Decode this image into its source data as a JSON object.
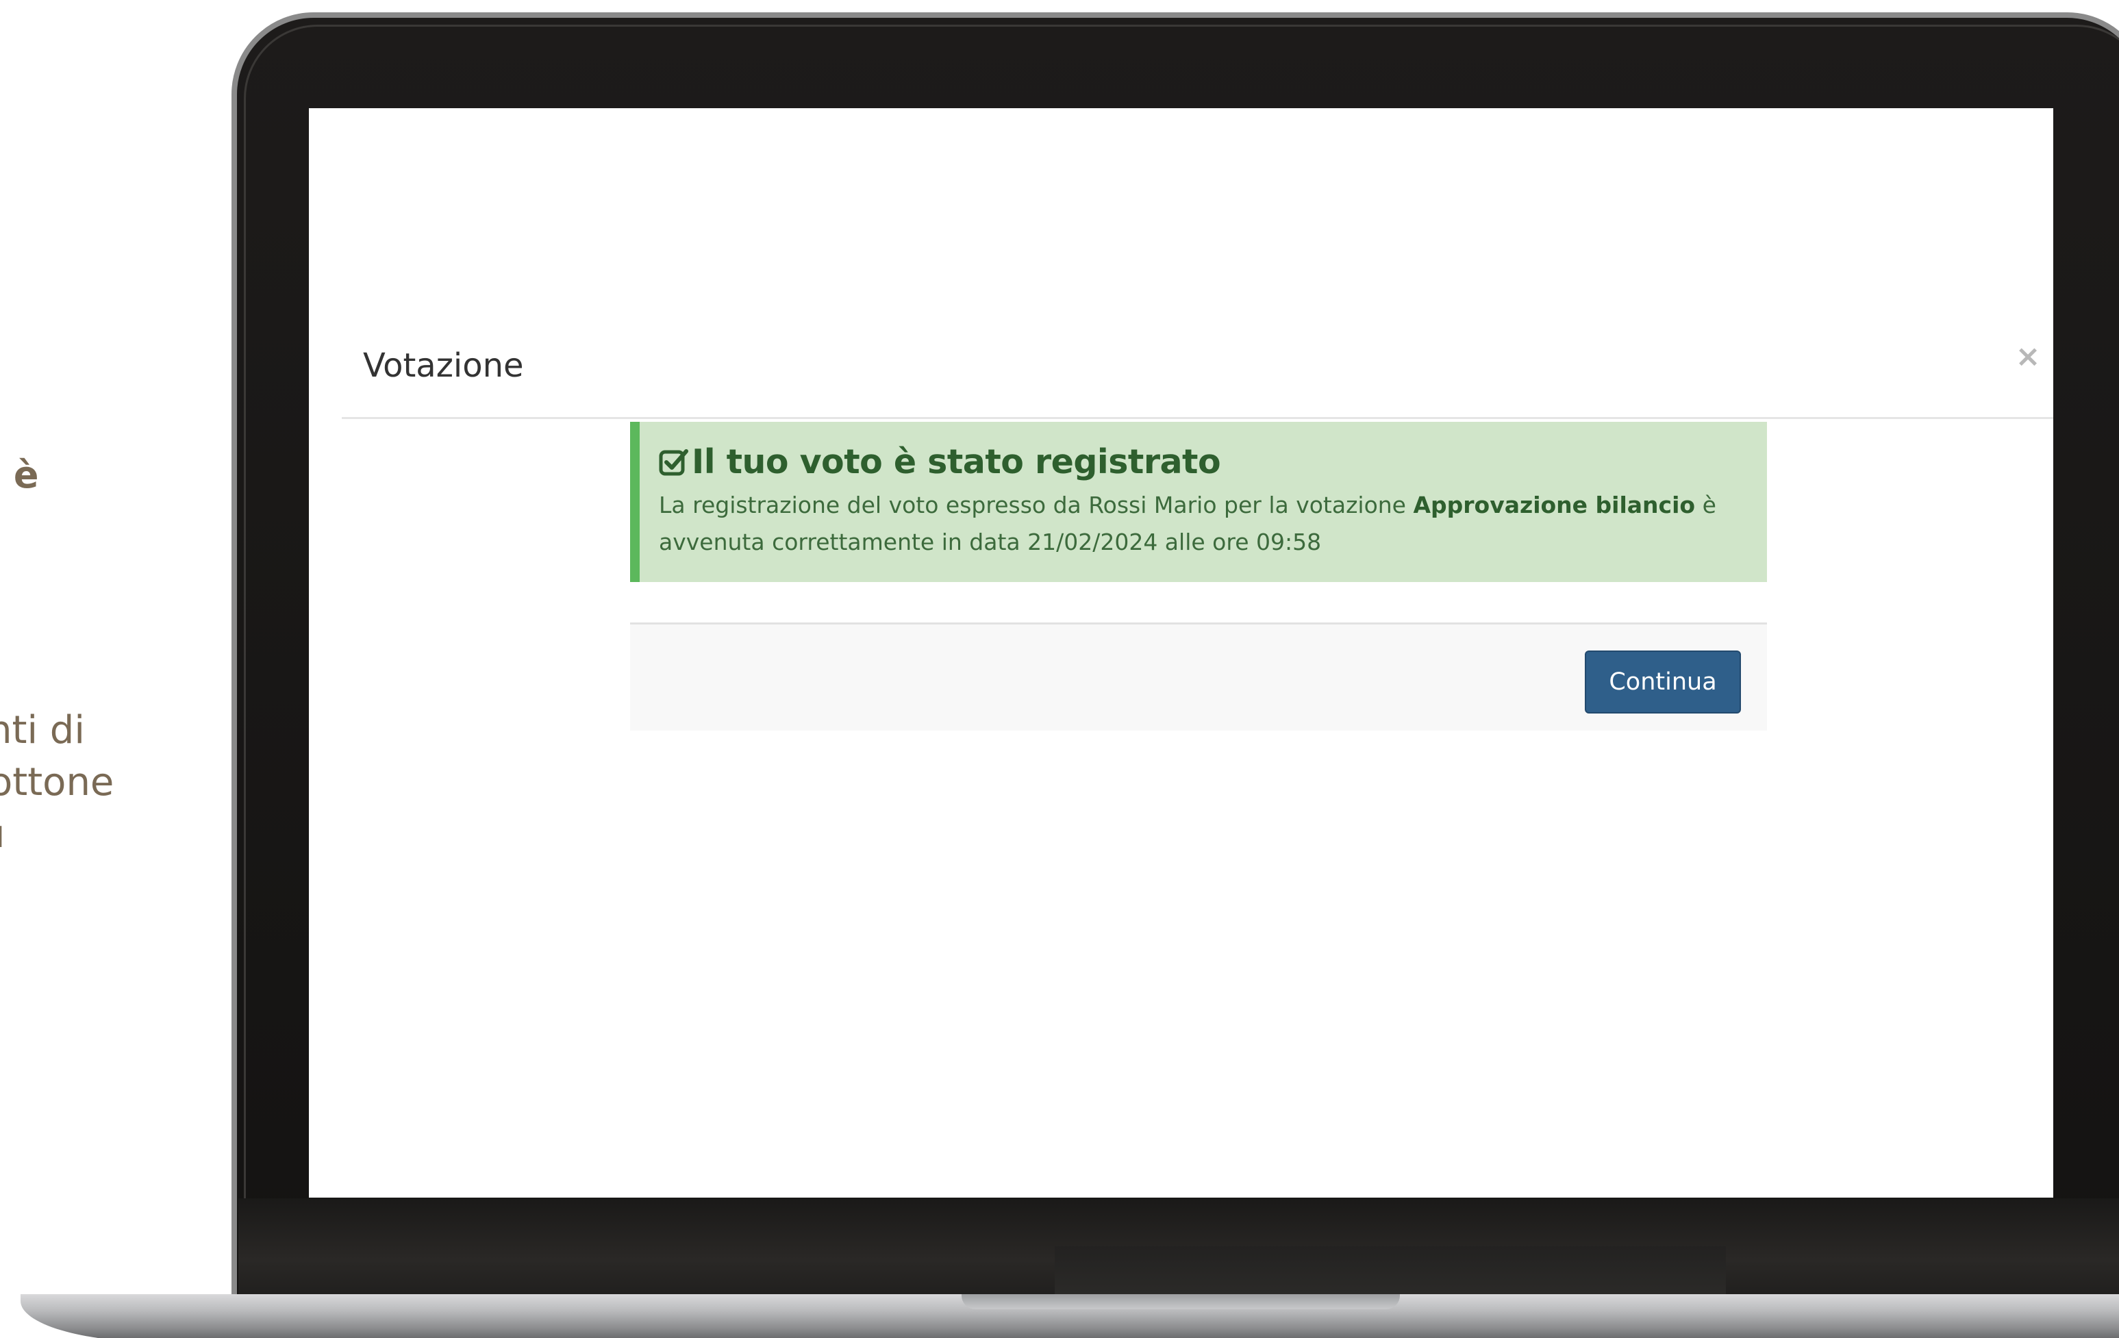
{
  "side_text": {
    "line1": "o è",
    "line2": "nti di",
    "line3": "ottone",
    "line4": "ı"
  },
  "modal": {
    "title": "Votazione",
    "close_symbol": "×"
  },
  "alert": {
    "icon": "check-square-icon",
    "heading": "Il tuo voto è stato registrato",
    "body_prefix": "La registrazione del voto espresso da Rossi Mario per la votazione ",
    "body_bold": "Approvazione bilancio",
    "body_suffix": " è avvenuta correttamente in data 21/02/2024 alle ore 09:58"
  },
  "footer": {
    "continue_label": "Continua"
  },
  "colors": {
    "alert_bg": "#d0e5c9",
    "alert_border": "#5cb85c",
    "alert_text": "#2e5f2e",
    "button_bg": "#2f5f8a",
    "side_text": "#7a6a55"
  }
}
